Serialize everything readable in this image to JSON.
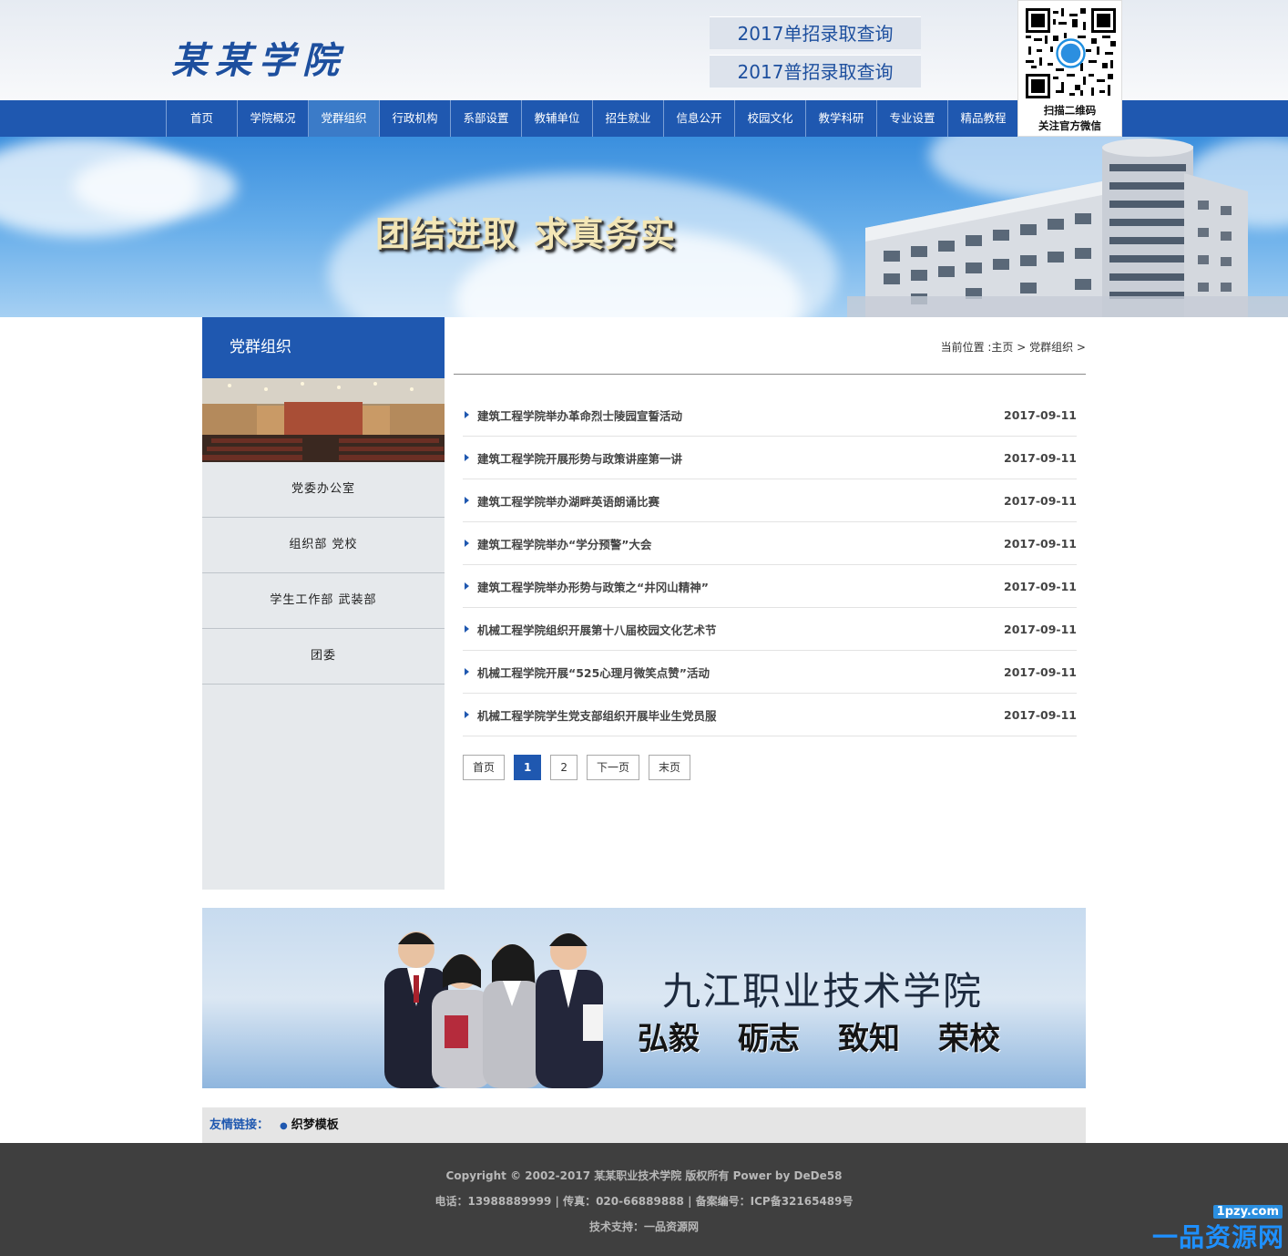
{
  "header": {
    "logo": "某某学院",
    "query_single": "2017单招录取查询",
    "query_general": "2017普招录取查询",
    "qr_line1": "扫描二维码",
    "qr_line2": "关注官方微信"
  },
  "nav": {
    "items": [
      "首页",
      "学院概况",
      "党群组织",
      "行政机构",
      "系部设置",
      "教辅单位",
      "招生就业",
      "信息公开",
      "校园文化",
      "教学科研",
      "专业设置",
      "精品教程"
    ],
    "active_index": 2
  },
  "banner": {
    "slogan_left": "团结进取",
    "slogan_right": "求真务实"
  },
  "sidebar": {
    "title": "党群组织",
    "items": [
      "党委办公室",
      "组织部 党校",
      "学生工作部 武装部",
      "团委"
    ]
  },
  "breadcrumb": {
    "text": "当前位置 :主页 > 党群组织 >"
  },
  "news": [
    {
      "title": "建筑工程学院举办革命烈士陵园宣誓活动",
      "date": "2017-09-11"
    },
    {
      "title": "建筑工程学院开展形势与政策讲座第一讲",
      "date": "2017-09-11"
    },
    {
      "title": "建筑工程学院举办湖畔英语朗诵比赛",
      "date": "2017-09-11"
    },
    {
      "title": "建筑工程学院举办“学分预警”大会",
      "date": "2017-09-11"
    },
    {
      "title": "建筑工程学院举办形势与政策之“井冈山精神”",
      "date": "2017-09-11"
    },
    {
      "title": "机械工程学院组织开展第十八届校园文化艺术节",
      "date": "2017-09-11"
    },
    {
      "title": "机械工程学院开展“525心理月微笑点赞”活动",
      "date": "2017-09-11"
    },
    {
      "title": "机械工程学院学生党支部组织开展毕业生党员服",
      "date": "2017-09-11"
    }
  ],
  "pager": {
    "first": "首页",
    "page1": "1",
    "page2": "2",
    "next": "下一页",
    "last": "末页"
  },
  "promo": {
    "title": "九江职业技术学院",
    "motto": [
      "弘毅",
      "砺志",
      "致知",
      "荣校"
    ]
  },
  "links": {
    "label": "友情链接：",
    "item": "织梦模板"
  },
  "footer": {
    "copyright": "Copyright © 2002-2017 某某职业技术学院 版权所有 Power by DeDe58",
    "contact": "电话：13988889999 | 传真：020-66889888 | 备案编号：ICP备32165489号",
    "support": "技术支持：一品资源网"
  },
  "watermark": {
    "domain": "1pzy.com",
    "text": "一品资源网"
  },
  "colors": {
    "brand_blue": "#1f58b0",
    "footer_bg": "#3f3f3f",
    "sidebar_bg": "#e6e9ec"
  }
}
